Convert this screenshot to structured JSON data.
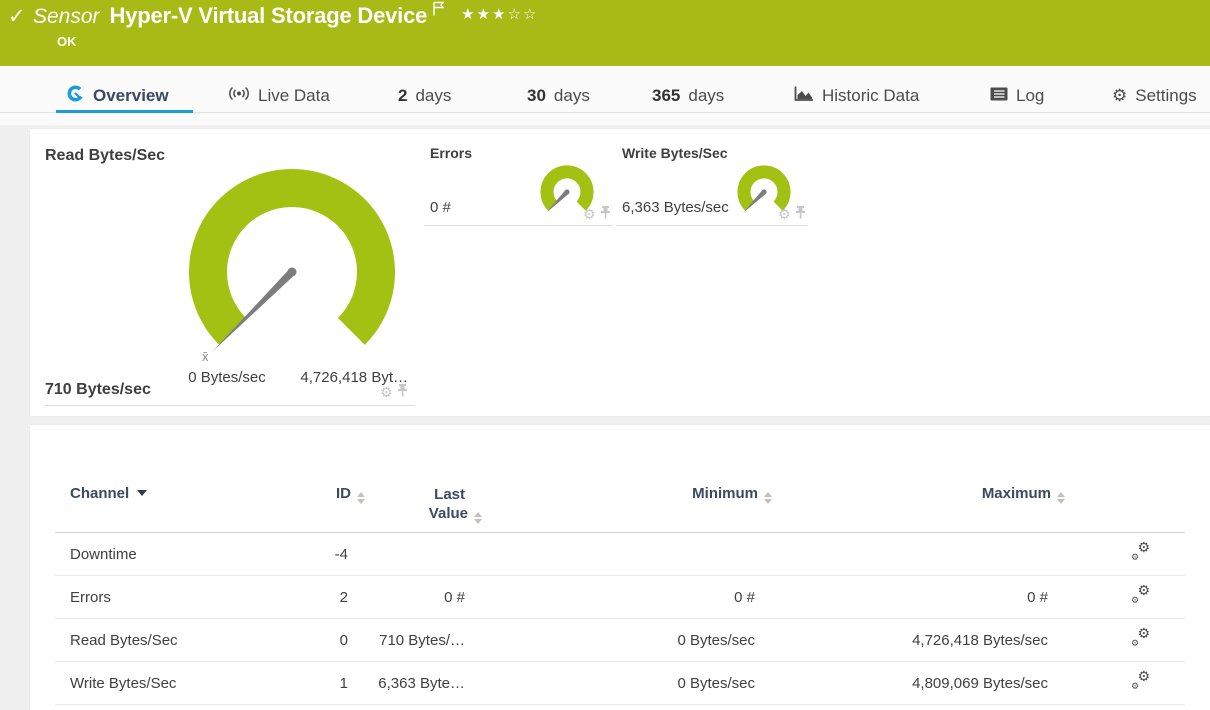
{
  "colors": {
    "header_green": "#a8ba16",
    "gauge_green": "#a3c113",
    "accent_blue": "#1e9cd8",
    "needle_gray": "#7d7d7d",
    "icon_light_gray": "#c7c7c7",
    "tab_text": "#4c4c4c",
    "table_header_text": "#3b4a63",
    "body_text": "#404040"
  },
  "icons": {
    "check": "✓",
    "gear": "⚙",
    "stars": "★★★☆☆"
  },
  "header": {
    "kind_label": "Sensor",
    "title": "Hyper-V Virtual Storage Device",
    "status_text": "OK"
  },
  "tabs": {
    "overview": "Overview",
    "live_data": "Live Data",
    "d2_num": "2",
    "d2_unit": "days",
    "d30_num": "30",
    "d30_unit": "days",
    "d365_num": "365",
    "d365_unit": "days",
    "historic": "Historic Data",
    "log": "Log",
    "settings": "Settings"
  },
  "gauges": {
    "main": {
      "title": "Read Bytes/Sec",
      "value": "710 Bytes/sec",
      "min_label": "0 Bytes/sec",
      "max_label": "4,726,418 Byt…",
      "mean_marker": "x̄"
    },
    "mini": [
      {
        "title": "Errors",
        "value": "0 #"
      },
      {
        "title": "Write Bytes/Sec",
        "value": "6,363 Bytes/sec"
      }
    ]
  },
  "table": {
    "header": {
      "channel": "Channel",
      "id": "ID",
      "last_line1": "Last",
      "last_line2": "Value",
      "minimum": "Minimum",
      "maximum": "Maximum"
    },
    "rows": [
      {
        "channel": "Downtime",
        "id": "-4",
        "last": "",
        "min": "",
        "max": ""
      },
      {
        "channel": "Errors",
        "id": "2",
        "last": "0 #",
        "min": "0 #",
        "max": "0 #"
      },
      {
        "channel": "Read Bytes/Sec",
        "id": "0",
        "last": "710 Bytes/…",
        "min": "0 Bytes/sec",
        "max": "4,726,418 Bytes/sec"
      },
      {
        "channel": "Write Bytes/Sec",
        "id": "1",
        "last": "6,363 Byte…",
        "min": "0 Bytes/sec",
        "max": "4,809,069 Bytes/sec"
      }
    ]
  }
}
